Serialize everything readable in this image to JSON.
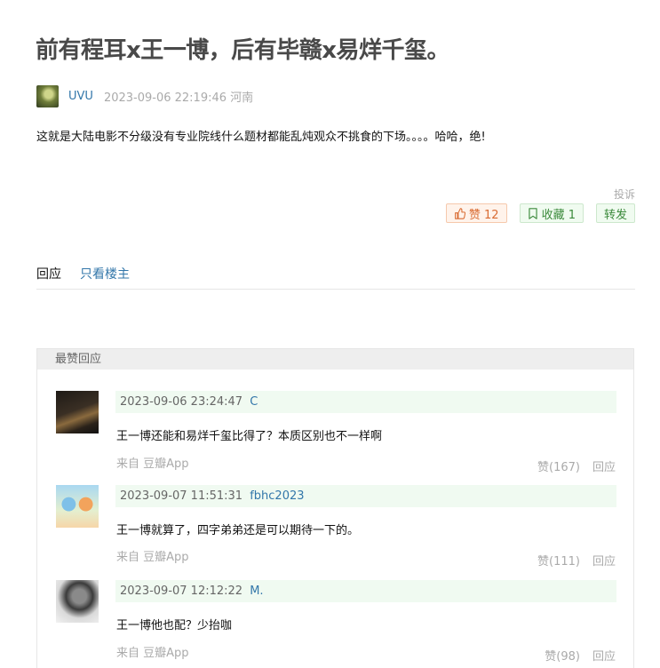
{
  "post": {
    "title": "前有程耳x王一博，后有毕赣x易烊千玺。",
    "author": "UVU",
    "meta": "2023-09-06 22:19:46 河南",
    "body": "这就是大陆电影不分级没有专业院线什么题材都能乱炖观众不挑食的下场。。。。哈哈，绝!",
    "report": "投诉",
    "like_label": "赞 12",
    "collect_label": "收藏 1",
    "share_label": "转发"
  },
  "tabs": {
    "replies": "回应",
    "op_only": "只看楼主"
  },
  "best": {
    "header": "最赞回应",
    "comments": [
      {
        "time": "2023-09-06 23:24:47",
        "user": "C",
        "text": "王一博还能和易烊千玺比得了？本质区别也不一样啊",
        "source": "来自 豆瓣App",
        "likes": "赞(167)",
        "reply": "回应"
      },
      {
        "time": "2023-09-07 11:51:31",
        "user": "fbhc2023",
        "text": "王一博就算了，四字弟弟还是可以期待一下的。",
        "source": "来自 豆瓣App",
        "likes": "赞(111)",
        "reply": "回应"
      },
      {
        "time": "2023-09-07 12:12:22",
        "user": "M.",
        "text": "王一博他也配？少抬咖",
        "source": "来自 豆瓣App",
        "likes": "赞(98)",
        "reply": "回应"
      }
    ]
  },
  "colors": {
    "link": "#3377aa",
    "like": "#d96b32",
    "collect": "#3b8a3b",
    "meta_bg": "#f0faf1"
  },
  "icons": {
    "like": "thumbs-up-icon",
    "collect": "bookmark-icon"
  }
}
